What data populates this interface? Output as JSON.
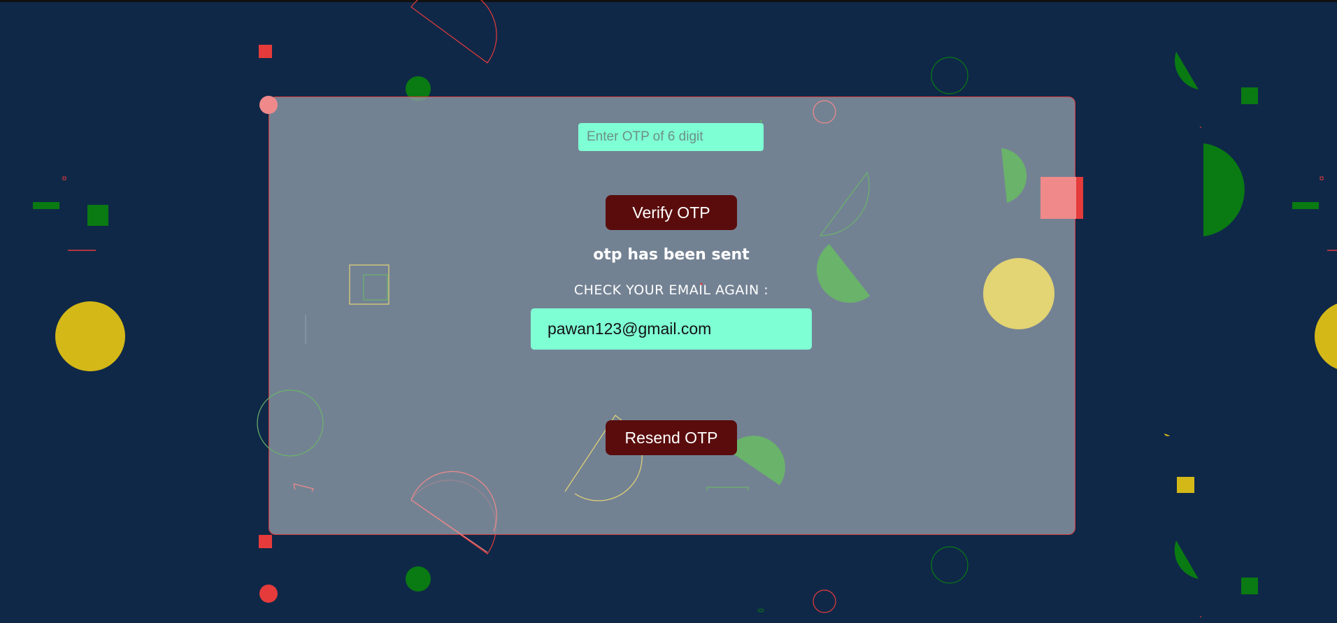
{
  "otp": {
    "placeholder": "Enter OTP of 6 digit",
    "value": ""
  },
  "buttons": {
    "verify_label": "Verify OTP",
    "resend_label": "Resend OTP"
  },
  "status": {
    "message": "otp has been sent",
    "check_label": "CHECK YOUR EMAIL AGAIN :",
    "email": "pawan123@gmail.com"
  },
  "colors": {
    "background": "#0f2848",
    "card": "#8a96a4",
    "card_border": "#d83a3a",
    "input_bg": "#7fffd4",
    "button_bg": "#5a0c0c",
    "accent_red": "#e53b3b",
    "accent_green": "#0a7a12",
    "accent_yellow": "#d4b818"
  }
}
